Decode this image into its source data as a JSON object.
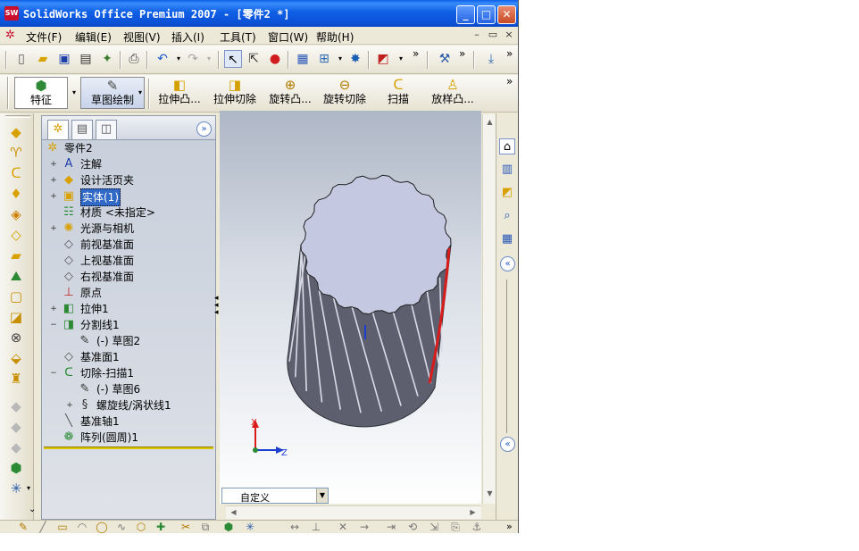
{
  "window": {
    "app_icon": "SW",
    "title": "SolidWorks Office Premium 2007 - [零件2 *]",
    "minimize": "_",
    "maximize": "□",
    "close": "✕"
  },
  "menubar": {
    "items": [
      "文件(F)",
      "编辑(E)",
      "视图(V)",
      "插入(I)",
      "工具(T)",
      "窗口(W)",
      "帮助(H)"
    ],
    "mdi": [
      "–",
      "▭",
      "×"
    ]
  },
  "toolbar1": {
    "icons": [
      "new-document-icon",
      "open-folder-icon",
      "save-icon",
      "print-preview-icon",
      "options-icon",
      "print-icon",
      "undo-icon",
      "redo-icon",
      "select-arrow-icon",
      "select-filter-icon",
      "traffic-light-icon",
      "grid-icon",
      "view-orientation-icon",
      "display-icon",
      "appearance-icon",
      "rebuild-icon",
      "reference-icon"
    ],
    "overflow": "»"
  },
  "command_manager": {
    "feature_label": "特征",
    "sketch_label": "草图绘制",
    "commands": [
      "拉伸凸...",
      "拉伸切除",
      "旋转凸...",
      "旋转切除",
      "扫描",
      "放样凸..."
    ],
    "overflow": "»"
  },
  "feature_manager": {
    "tabs": [
      "feature-tree-tab",
      "property-tab",
      "configuration-tab"
    ],
    "expand": "»",
    "tree": [
      {
        "label": "零件2",
        "level": 0,
        "icon": "part-icon",
        "expander": ""
      },
      {
        "label": "注解",
        "level": 1,
        "icon": "annotation-icon",
        "expander": "+"
      },
      {
        "label": "设计活页夹",
        "level": 1,
        "icon": "binder-icon",
        "expander": "+"
      },
      {
        "label": "实体(1)",
        "level": 1,
        "icon": "solid-body-icon",
        "expander": "+",
        "selected": true
      },
      {
        "label": "材质 <未指定>",
        "level": 1,
        "icon": "material-icon",
        "expander": ""
      },
      {
        "label": "光源与相机",
        "level": 1,
        "icon": "lights-icon",
        "expander": "+"
      },
      {
        "label": "前视基准面",
        "level": 1,
        "icon": "plane-icon",
        "expander": ""
      },
      {
        "label": "上视基准面",
        "level": 1,
        "icon": "plane-icon",
        "expander": ""
      },
      {
        "label": "右视基准面",
        "level": 1,
        "icon": "plane-icon",
        "expander": ""
      },
      {
        "label": "原点",
        "level": 1,
        "icon": "origin-icon",
        "expander": ""
      },
      {
        "label": "拉伸1",
        "level": 1,
        "icon": "extrude-icon",
        "expander": "+"
      },
      {
        "label": "分割线1",
        "level": 1,
        "icon": "split-line-icon",
        "expander": "−"
      },
      {
        "label": "(-) 草图2",
        "level": 2,
        "icon": "sketch-icon",
        "expander": ""
      },
      {
        "label": "基准面1",
        "level": 1,
        "icon": "plane-icon",
        "expander": ""
      },
      {
        "label": "切除-扫描1",
        "level": 1,
        "icon": "cut-sweep-icon",
        "expander": "−"
      },
      {
        "label": "(-) 草图6",
        "level": 2,
        "icon": "sketch-icon",
        "expander": ""
      },
      {
        "label": "螺旋线/涡状线1",
        "level": 2,
        "icon": "helix-icon",
        "expander": "+"
      },
      {
        "label": "基准轴1",
        "level": 1,
        "icon": "axis-icon",
        "expander": ""
      },
      {
        "label": "阵列(圆周)1",
        "level": 1,
        "icon": "circular-pattern-icon",
        "expander": ""
      }
    ]
  },
  "graphics": {
    "axis_x": "X",
    "axis_z": "Z",
    "view_orientation": "自定义",
    "colors": {
      "part_body": "#5d5f6e",
      "part_top": "#c4c8e0",
      "edge_highlight": "#d81b1b",
      "background_top": "#aeb7c6",
      "background_bottom": "#ffffff"
    }
  },
  "taskpane": {
    "icons": [
      "home-icon",
      "design-library-icon",
      "file-explorer-icon",
      "search-icon",
      "view-palette-icon"
    ],
    "collapse": "«"
  }
}
